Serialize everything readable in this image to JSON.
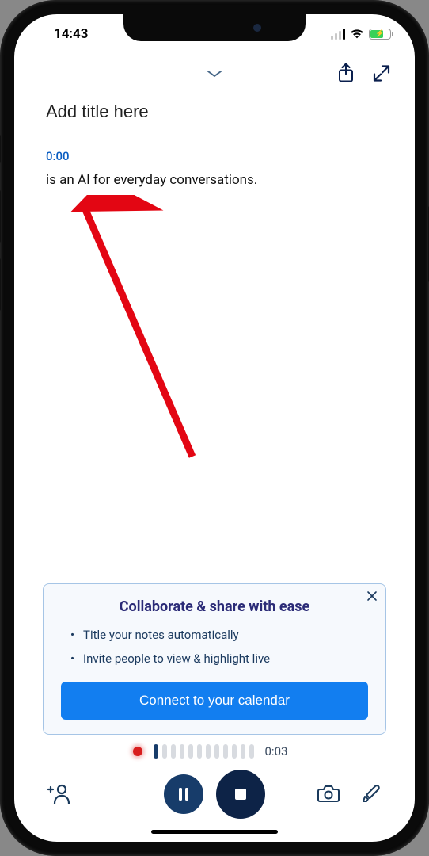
{
  "status_bar": {
    "time": "14:43"
  },
  "header": {},
  "title": {
    "placeholder": "Add title here",
    "value": ""
  },
  "transcript": {
    "timestamp": "0:00",
    "text": "is an AI for everyday conversations."
  },
  "promo": {
    "title": "Collaborate & share with ease",
    "bullets": [
      "Title your notes automatically",
      "Invite people to view & highlight live"
    ],
    "cta": "Connect to your calendar"
  },
  "recording": {
    "elapsed": "0:03"
  }
}
